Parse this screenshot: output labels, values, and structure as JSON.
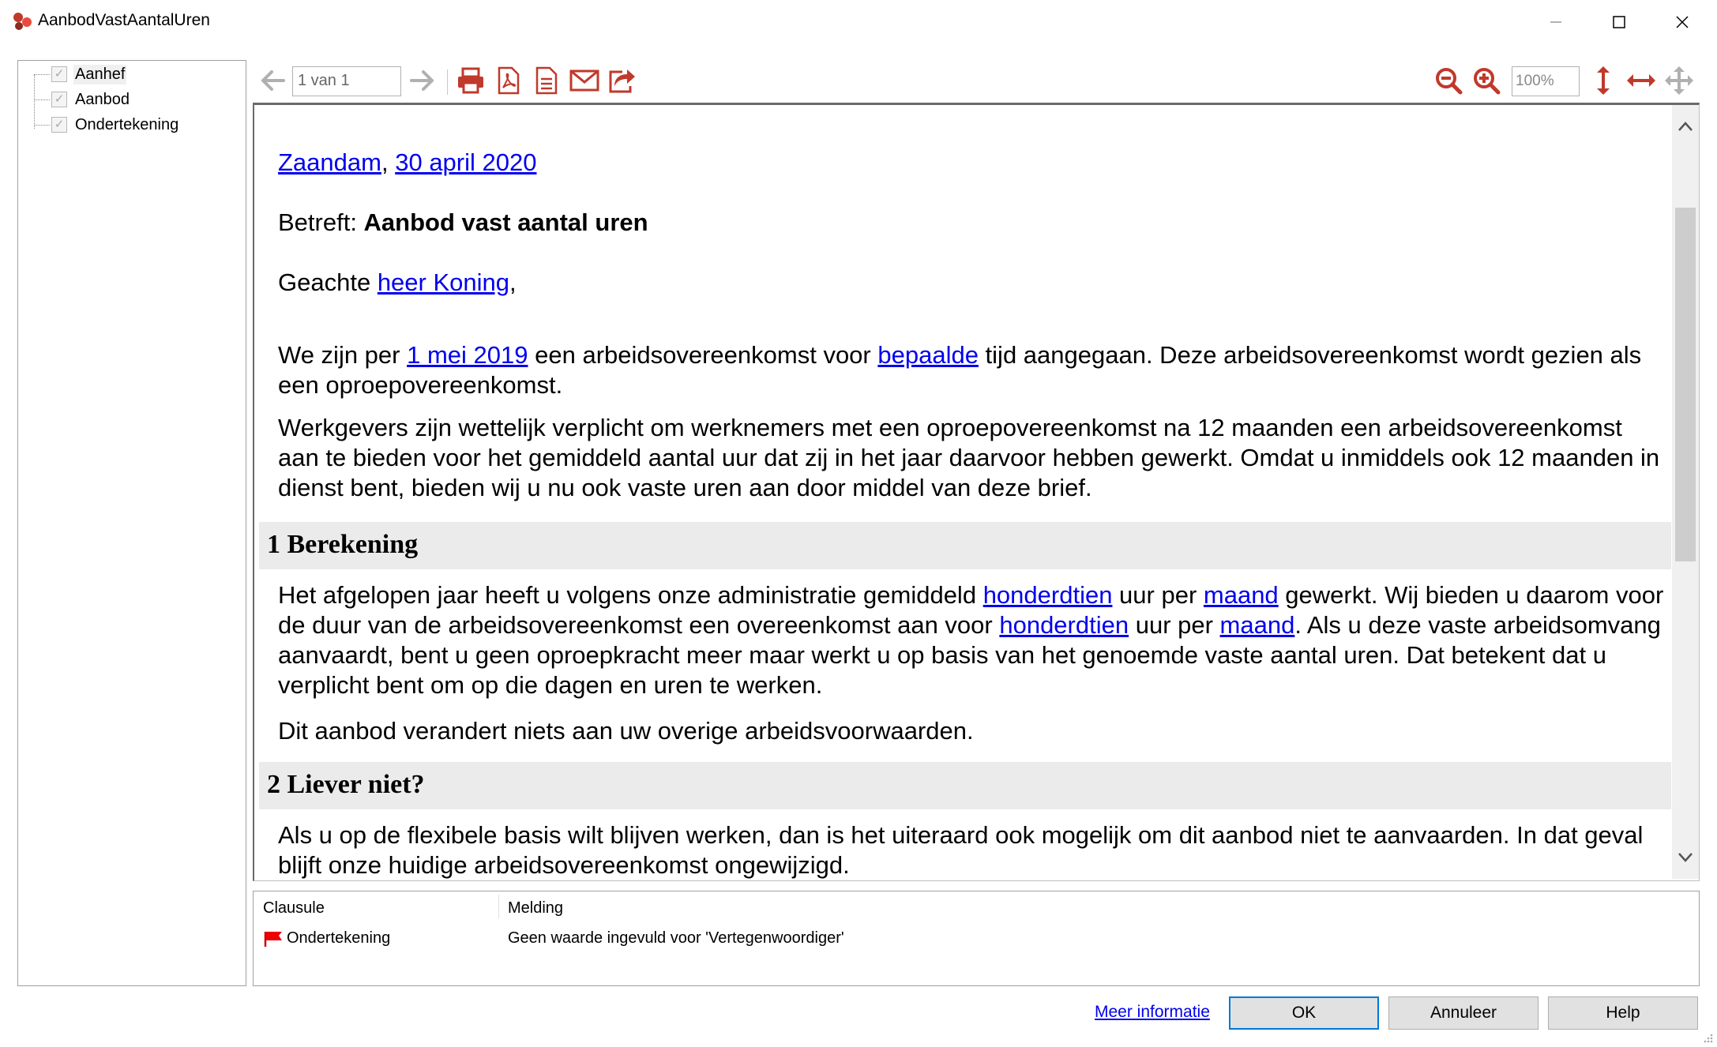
{
  "window": {
    "title": "AanbodVastAantalUren"
  },
  "tree": {
    "items": [
      {
        "label": "Aanhef",
        "checked": true,
        "selected": true
      },
      {
        "label": "Aanbod",
        "checked": true,
        "selected": false
      },
      {
        "label": "Ondertekening",
        "checked": true,
        "selected": false
      }
    ]
  },
  "toolbar": {
    "page_value": "1 van 1",
    "zoom_value": "100%",
    "icon_color": "#c0392b"
  },
  "document": {
    "place": "Zaandam",
    "comma1": ",",
    "date": "30 april 2020",
    "subject_prefix": "Betreft: ",
    "subject": "Aanbod vast aantal uren",
    "greeting_prefix": "Geachte ",
    "greeting_name": "heer Koning",
    "greeting_suffix": ",",
    "p1_a": "We zijn per ",
    "p1_date": "1 mei 2019",
    "p1_b": " een arbeidsovereenkomst voor ",
    "p1_type": "bepaalde",
    "p1_c": " tijd aangegaan. Deze arbeidsovereenkomst wordt gezien als een oproepovereenkomst.",
    "p2": "Werkgevers zijn wettelijk verplicht om werknemers met een oproepovereenkomst na 12 maanden een arbeidsovereenkomst aan te bieden voor het gemiddeld aantal uur dat zij in het jaar daarvoor hebben gewerkt. Omdat u inmiddels ook 12 maanden in dienst bent, bieden wij u nu ook vaste uren aan door middel van deze brief.",
    "h1": "1 Berekening",
    "p3_a": "Het afgelopen jaar heeft u volgens onze administratie gemiddeld ",
    "p3_hours1": "honderdtien",
    "p3_b": " uur per ",
    "p3_period1": "maand",
    "p3_c": " gewerkt. Wij bieden u daarom voor de duur van de arbeidsovereenkomst een overeenkomst aan voor ",
    "p3_hours2": "honderdtien",
    "p3_d": " uur per ",
    "p3_period2": "maand",
    "p3_e": ". Als u deze vaste arbeidsomvang aanvaardt, bent u geen oproepkracht meer maar werkt u op basis van het genoemde vaste aantal uren. Dat betekent dat u verplicht bent om op die dagen en uren te werken.",
    "p4": "Dit aanbod verandert niets aan uw overige arbeidsvoorwaarden.",
    "h2": "2 Liever niet?",
    "p5": "Als u op de flexibele basis wilt blijven werken, dan is het uiteraard ook mogelijk om dit aanbod niet te aanvaarden. In dat geval blijft onze huidige arbeidsovereenkomst ongewijzigd.",
    "link_color": "#0000ee",
    "heading_bg": "#ebebeb"
  },
  "messages": {
    "col_clause": "Clausule",
    "col_message": "Melding",
    "rows": [
      {
        "clause": "Ondertekening",
        "message": "Geen waarde ingevuld voor 'Vertegenwoordiger'",
        "icon": "red-flag-icon"
      }
    ]
  },
  "footer": {
    "more_info": "Meer informatie",
    "ok": "OK",
    "cancel": "Annuleer",
    "help": "Help"
  }
}
